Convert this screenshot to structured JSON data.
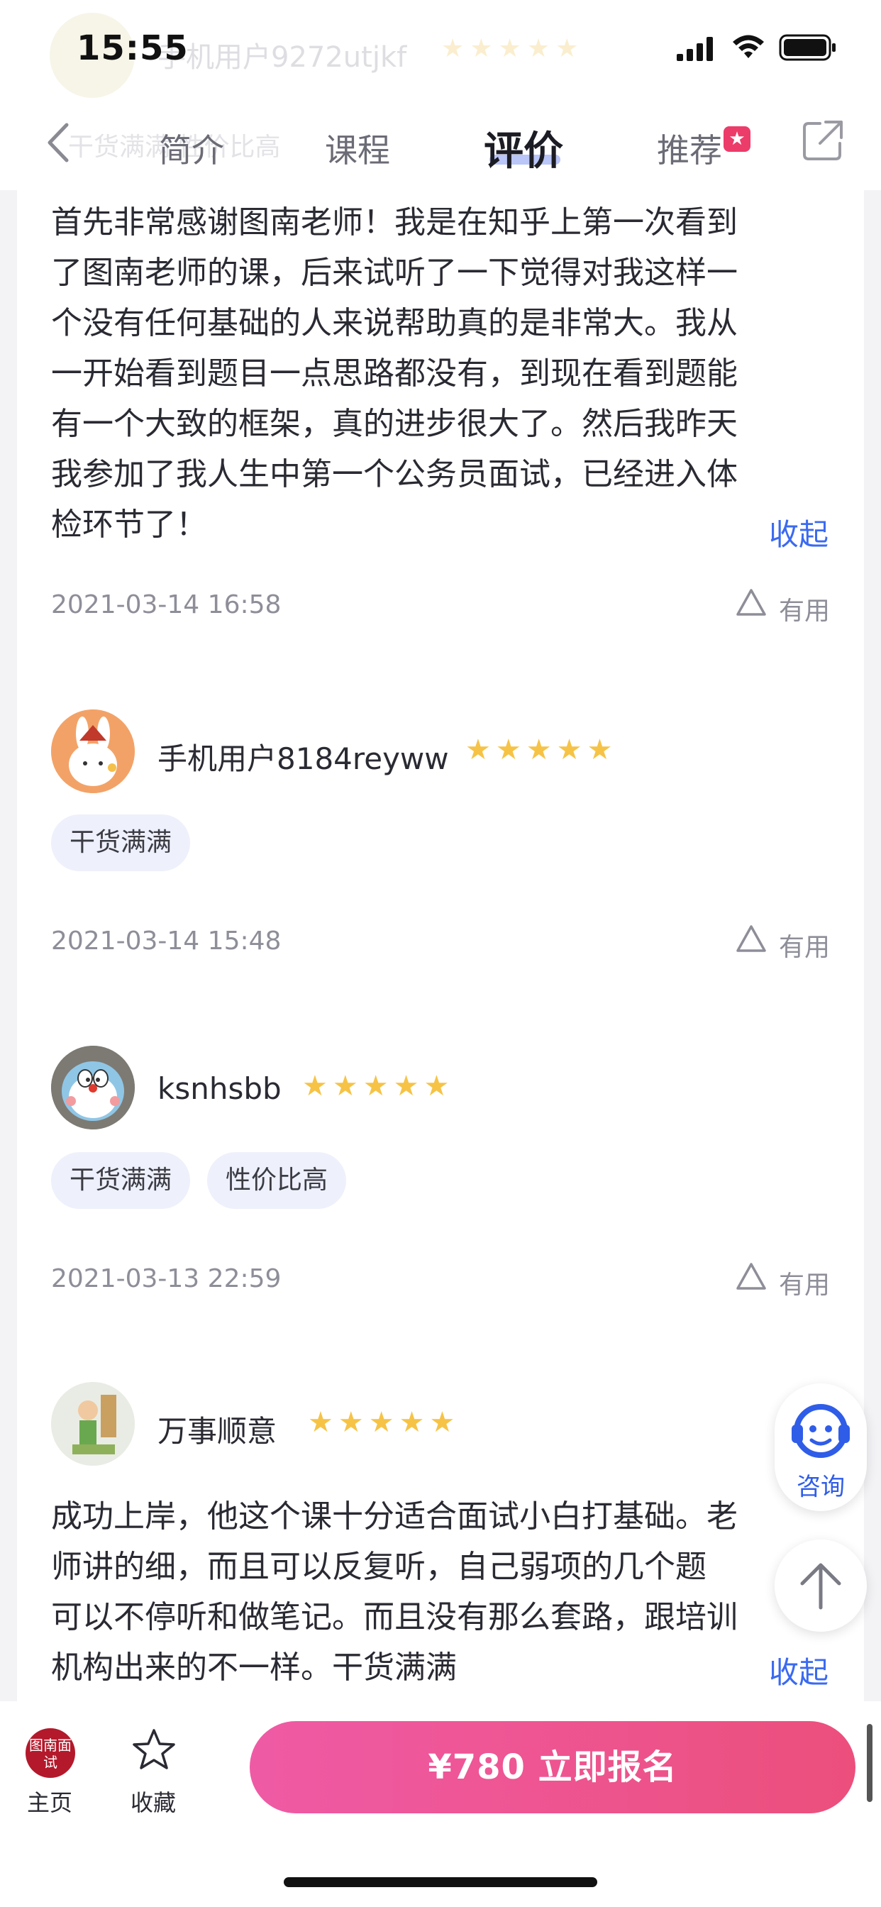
{
  "status_bar": {
    "time": "15:55",
    "ghost_user_name": "手机用户9272utjkf",
    "ghost_stars": "★★★★★"
  },
  "header": {
    "ghost_tags": "干货满满 性价比高",
    "tabs": [
      {
        "label": "简介",
        "active": false
      },
      {
        "label": "课程",
        "active": false
      },
      {
        "label": "评价",
        "active": true
      },
      {
        "label": "推荐",
        "active": false
      }
    ]
  },
  "reviews": [
    {
      "text_lines": [
        "首先非常感谢图南老师！我是在知乎上第一次看到",
        "了图南老师的课，后来试听了一下觉得对我这样一",
        "个没有任何基础的人来说帮助真的是非常大。我从",
        "一开始看到题目一点思路都没有，到现在看到题能",
        "有一个大致的框架，真的进步很大了。然后我昨天",
        "我参加了我人生中第一个公务员面试，已经进入体",
        "检环节了！"
      ],
      "collapse_label": "收起",
      "date": "2021-03-14 16:58",
      "useful_label": "有用"
    },
    {
      "user": "手机用户8184reyww",
      "rating": 5,
      "stars": "★★★★★",
      "tags": [
        "干货满满"
      ],
      "date": "2021-03-14 15:48",
      "useful_label": "有用"
    },
    {
      "user": "ksnhsbb",
      "rating": 5,
      "stars": "★★★★★",
      "tags": [
        "干货满满",
        "性价比高"
      ],
      "date": "2021-03-13 22:59",
      "useful_label": "有用"
    },
    {
      "user": "万事顺意",
      "rating": 5,
      "stars": "★★★★★",
      "text_lines": [
        "成功上岸，他这个课十分适合面试小白打基础。老",
        "师讲的细，而且可以反复听，自己弱项的几个题",
        "可以不停听和做笔记。而且没有那么套路，跟培训",
        "机构出来的不一样。干货满满"
      ],
      "collapse_label": "收起"
    }
  ],
  "floating": {
    "consult_label": "咨询"
  },
  "bottom_bar": {
    "logo_text": "图南面试",
    "home_label": "主页",
    "favorite_label": "收藏",
    "enroll_label": "¥780 立即报名"
  },
  "colors": {
    "accent_blue": "#3b6af0",
    "star_gold": "#f6c346",
    "enroll_gradient_start": "#ef5aa5",
    "enroll_gradient_end": "#ec4f7c",
    "badge_red": "#ec3c6a",
    "tag_bg": "#eef0fb"
  },
  "icons": [
    "signal-icon",
    "wifi-icon",
    "battery-icon",
    "back-icon",
    "share-icon",
    "triangle-useful-icon",
    "headset-face-icon",
    "arrow-up-icon",
    "star-outline-icon",
    "hot-badge-icon"
  ]
}
